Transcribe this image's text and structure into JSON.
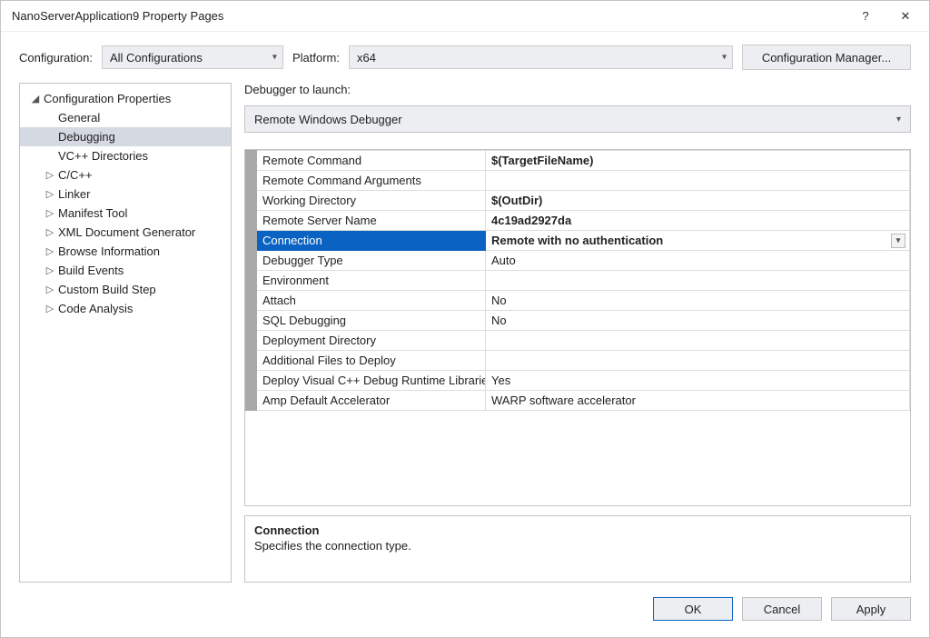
{
  "window": {
    "title": "NanoServerApplication9 Property Pages",
    "help_symbol": "?",
    "close_symbol": "✕"
  },
  "toolbar": {
    "configuration_label": "Configuration:",
    "configuration_value": "All Configurations",
    "platform_label": "Platform:",
    "platform_value": "x64",
    "config_manager": "Configuration Manager..."
  },
  "tree": {
    "root": "Configuration Properties",
    "items": [
      {
        "label": "General",
        "expander": "",
        "indent": 2,
        "selected": false
      },
      {
        "label": "Debugging",
        "expander": "",
        "indent": 2,
        "selected": true
      },
      {
        "label": "VC++ Directories",
        "expander": "",
        "indent": 2,
        "selected": false
      },
      {
        "label": "C/C++",
        "expander": "▷",
        "indent": 1,
        "selected": false
      },
      {
        "label": "Linker",
        "expander": "▷",
        "indent": 1,
        "selected": false
      },
      {
        "label": "Manifest Tool",
        "expander": "▷",
        "indent": 1,
        "selected": false
      },
      {
        "label": "XML Document Generator",
        "expander": "▷",
        "indent": 1,
        "selected": false
      },
      {
        "label": "Browse Information",
        "expander": "▷",
        "indent": 1,
        "selected": false
      },
      {
        "label": "Build Events",
        "expander": "▷",
        "indent": 1,
        "selected": false
      },
      {
        "label": "Custom Build Step",
        "expander": "▷",
        "indent": 1,
        "selected": false
      },
      {
        "label": "Code Analysis",
        "expander": "▷",
        "indent": 1,
        "selected": false
      }
    ]
  },
  "launch": {
    "label": "Debugger to launch:",
    "value": "Remote Windows Debugger"
  },
  "props": [
    {
      "name": "Remote Command",
      "value": "$(TargetFileName)",
      "bold": true,
      "selected": false
    },
    {
      "name": "Remote Command Arguments",
      "value": "",
      "bold": false,
      "selected": false
    },
    {
      "name": "Working Directory",
      "value": "$(OutDir)",
      "bold": true,
      "selected": false
    },
    {
      "name": "Remote Server Name",
      "value": "4c19ad2927da",
      "bold": true,
      "selected": false
    },
    {
      "name": "Connection",
      "value": "Remote with no authentication",
      "bold": true,
      "selected": true
    },
    {
      "name": "Debugger Type",
      "value": "Auto",
      "bold": false,
      "selected": false
    },
    {
      "name": "Environment",
      "value": "",
      "bold": false,
      "selected": false
    },
    {
      "name": "Attach",
      "value": "No",
      "bold": false,
      "selected": false
    },
    {
      "name": "SQL Debugging",
      "value": "No",
      "bold": false,
      "selected": false
    },
    {
      "name": "Deployment Directory",
      "value": "",
      "bold": false,
      "selected": false
    },
    {
      "name": "Additional Files to Deploy",
      "value": "",
      "bold": false,
      "selected": false
    },
    {
      "name": "Deploy Visual C++ Debug Runtime Libraries",
      "value": "Yes",
      "bold": false,
      "selected": false
    },
    {
      "name": "Amp Default Accelerator",
      "value": "WARP software accelerator",
      "bold": false,
      "selected": false
    }
  ],
  "description": {
    "title": "Connection",
    "text": "Specifies the connection type."
  },
  "buttons": {
    "ok": "OK",
    "cancel": "Cancel",
    "apply": "Apply"
  }
}
